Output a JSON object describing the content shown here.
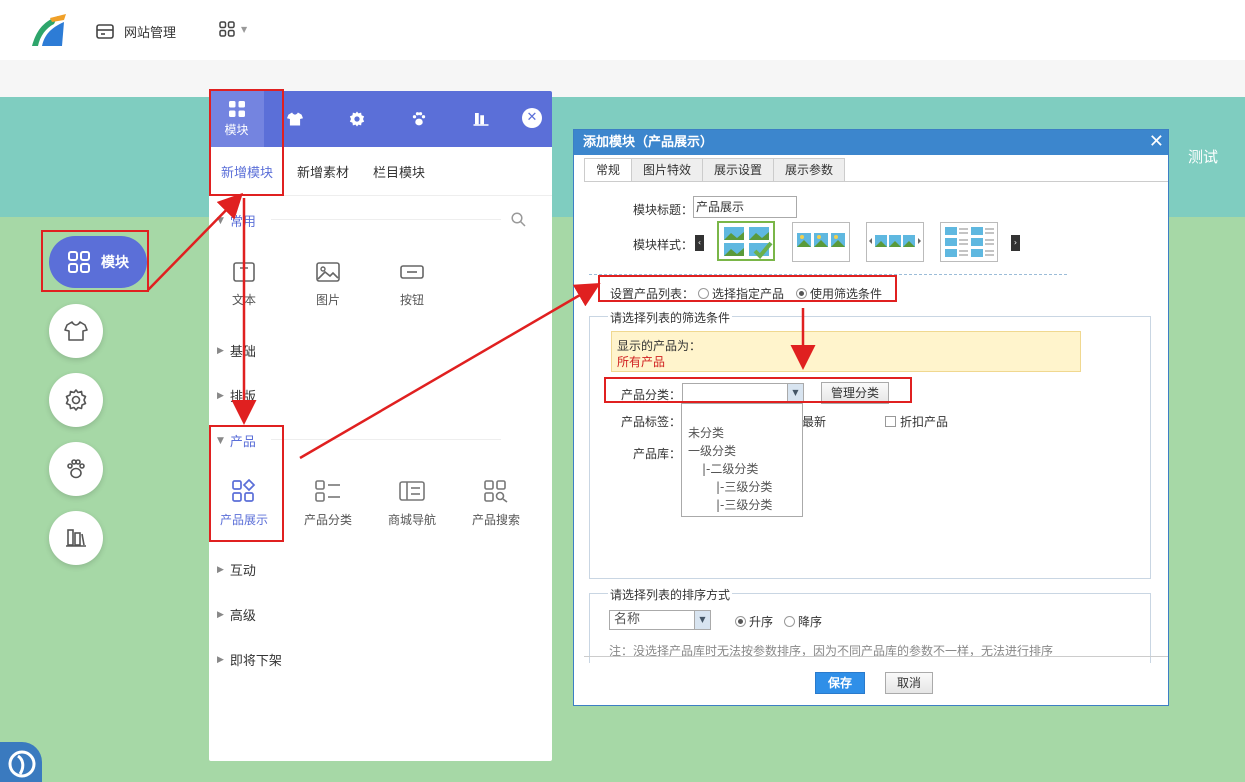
{
  "topbar": {
    "site_manage_label": "网站管理"
  },
  "banner": {
    "test_label": "测试"
  },
  "dock": {
    "main_label": "模块"
  },
  "panel": {
    "tabs": [
      {
        "icon": "grid-icon",
        "label": "模块"
      },
      {
        "icon": "shirt-icon"
      },
      {
        "icon": "gear-icon"
      },
      {
        "icon": "paw-icon"
      },
      {
        "icon": "books-icon"
      }
    ],
    "subtabs": [
      "新增模块",
      "新增素材",
      "栏目模块"
    ],
    "sections": {
      "common": "常用",
      "basic": "基础",
      "layout": "排版",
      "product": "产品",
      "interact": "互动",
      "advanced": "高级",
      "soon_removed": "即将下架"
    },
    "common_items": [
      "文本",
      "图片",
      "按钮"
    ],
    "product_items": [
      "产品展示",
      "产品分类",
      "商城导航",
      "产品搜索"
    ]
  },
  "dialog": {
    "title": "添加模块（产品展示）",
    "tabs": [
      "常规",
      "图片特效",
      "展示设置",
      "展示参数"
    ],
    "module_title_label": "模块标题：",
    "module_title_value": "产品展示",
    "module_style_label": "模块样式：",
    "product_list_label": "设置产品列表：",
    "product_list_options": [
      "选择指定产品",
      "使用筛选条件"
    ],
    "filter_legend": "请选择列表的筛选条件",
    "display_products_label": "显示的产品为：",
    "display_products_value": "所有产品",
    "category_label": "产品分类：",
    "manage_category_button": "管理分类",
    "tag_label": "产品标签：",
    "tag_newest": "最新",
    "tag_discount": "折扣产品",
    "library_label": "产品库：",
    "category_options": [
      "未分类",
      "一级分类",
      "|-二级分类",
      "|-三级分类",
      "|-三级分类"
    ],
    "sort_legend": "请选择列表的排序方式",
    "sort_field": "名称",
    "sort_asc": "升序",
    "sort_desc": "降序",
    "sort_note": "注：没选择产品库时无法按参数排序，因为不同产品库的参数不一样，无法进行排序",
    "save_button": "保存",
    "cancel_button": "取消"
  },
  "colors": {
    "accent": "#5b6fd8",
    "dialog_header": "#3c86cd",
    "annotation": "#e02020",
    "teal_banner": "#7fcdc0",
    "green_bg": "#a6d8a6"
  }
}
